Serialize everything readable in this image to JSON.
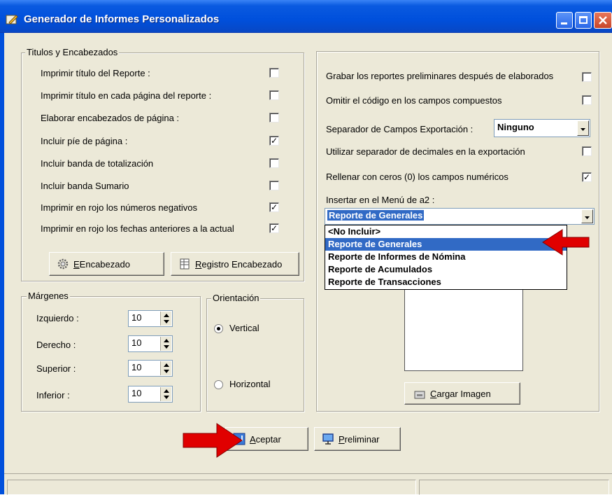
{
  "window": {
    "title": "Generador de Informes Personalizados"
  },
  "titles_group": {
    "legend": "Titulos y Encabezados",
    "options": [
      {
        "label": "Imprimir título del Reporte :",
        "checked": false
      },
      {
        "label": "Imprimir título en cada página del reporte :",
        "checked": false
      },
      {
        "label": "Elaborar encabezados de página :",
        "checked": false
      },
      {
        "label": "Incluir píe de página :",
        "checked": true
      },
      {
        "label": "Incluir banda de totalización",
        "checked": false
      },
      {
        "label": "Incluir banda Sumario",
        "checked": false
      },
      {
        "label": "Imprimir en rojo los números negativos",
        "checked": true
      },
      {
        "label": "Imprimir en rojo los fechas anteriores a la actual",
        "checked": true
      }
    ],
    "encabezado_button": "Encabezado",
    "encabezado_mnemonic": "E",
    "registro_button": "egistro Encabezado",
    "registro_mnemonic": "R"
  },
  "margins_group": {
    "legend": "Márgenes",
    "fields": [
      {
        "label": "Izquierdo :",
        "value": "10"
      },
      {
        "label": "Derecho :",
        "value": "10"
      },
      {
        "label": "Superior :",
        "value": "10"
      },
      {
        "label": "Inferior :",
        "value": "10"
      }
    ]
  },
  "orientation_group": {
    "legend": "Orientación",
    "options": [
      {
        "label": "Vertical",
        "selected": true
      },
      {
        "label": "Horizontal",
        "selected": false
      }
    ]
  },
  "right_panel": {
    "options": [
      {
        "label": "Grabar los reportes preliminares después de elaborados",
        "checked": false
      },
      {
        "label": "Omitir el código en los campos compuestos",
        "checked": false
      },
      {
        "label": "Utilizar separador de decimales en la exportación",
        "checked": false
      },
      {
        "label": "Rellenar con ceros (0) los campos numéricos",
        "checked": true
      }
    ],
    "separator_label": "Separador de Campos Exportación :",
    "separator_value": "Ninguno",
    "menu_label": "Insertar en  el Menú de a2 :",
    "menu_value": "Reporte de Generales",
    "menu_options": [
      "<No Incluir>",
      "Reporte de Generales",
      "Reporte de Informes de Nómina",
      "Reporte de Acumulados",
      "Reporte de Transacciones"
    ],
    "menu_selected_index": 1,
    "load_image_button": "argar Imagen",
    "load_image_mnemonic": "C"
  },
  "footer": {
    "accept_button": "ceptar",
    "accept_mnemonic": "A",
    "preview_button": "reliminar",
    "preview_mnemonic": "P"
  },
  "colors": {
    "title_bar": "#0050dc",
    "face": "#ece9d8",
    "selection": "#316ac5",
    "arrow": "#e00000"
  }
}
